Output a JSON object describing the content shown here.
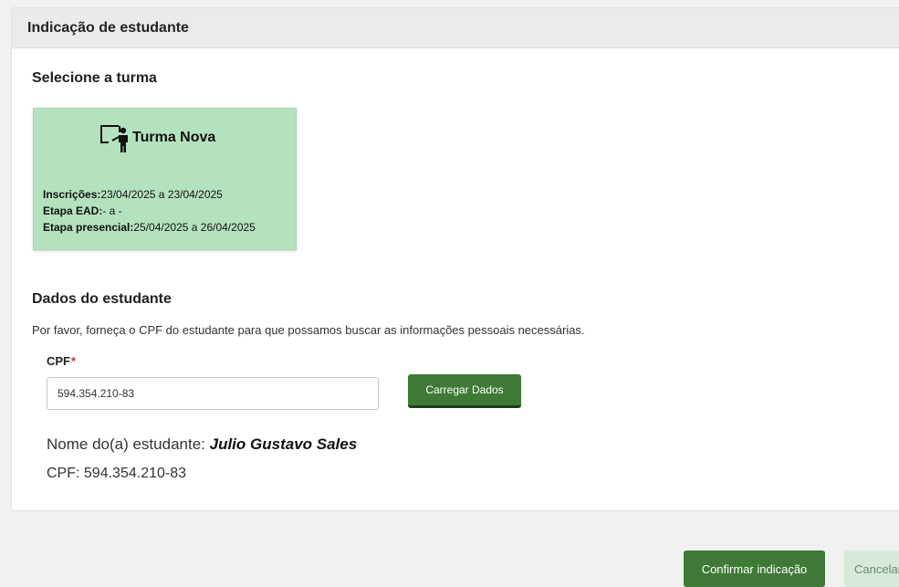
{
  "header": {
    "title": "Indicação de estudante"
  },
  "class_section": {
    "title": "Selecione a turma",
    "card": {
      "icon": "teacher-board-icon",
      "name": "Turma Nova",
      "enrollment_label": "Inscrições:",
      "enrollment_value": "23/04/2025 a 23/04/2025",
      "ead_label": "Etapa EAD:",
      "ead_value": "- a -",
      "presential_label": "Etapa presencial:",
      "presential_value": "25/04/2025 a 26/04/2025",
      "color": "#b5e2be"
    }
  },
  "student_section": {
    "title": "Dados do estudante",
    "description": "Por favor, forneça o CPF do estudante para que possamos buscar as informações pessoais necessárias.",
    "cpf_label": "CPF",
    "required_marker": "*",
    "cpf_value": "594.354.210-83",
    "load_button": "Carregar Dados",
    "name_label": "Nome do(a) estudante:",
    "name_value": "Julio Gustavo Sales",
    "cpf_line_label": "CPF:",
    "cpf_line_value": "594.354.210-83"
  },
  "footer": {
    "confirm_button": "Confirmar indicação",
    "cancel_button": "Cancelar"
  },
  "colors": {
    "primary": "#3e7a35",
    "card_bg": "#b5e2be",
    "required": "#d32f2f"
  }
}
